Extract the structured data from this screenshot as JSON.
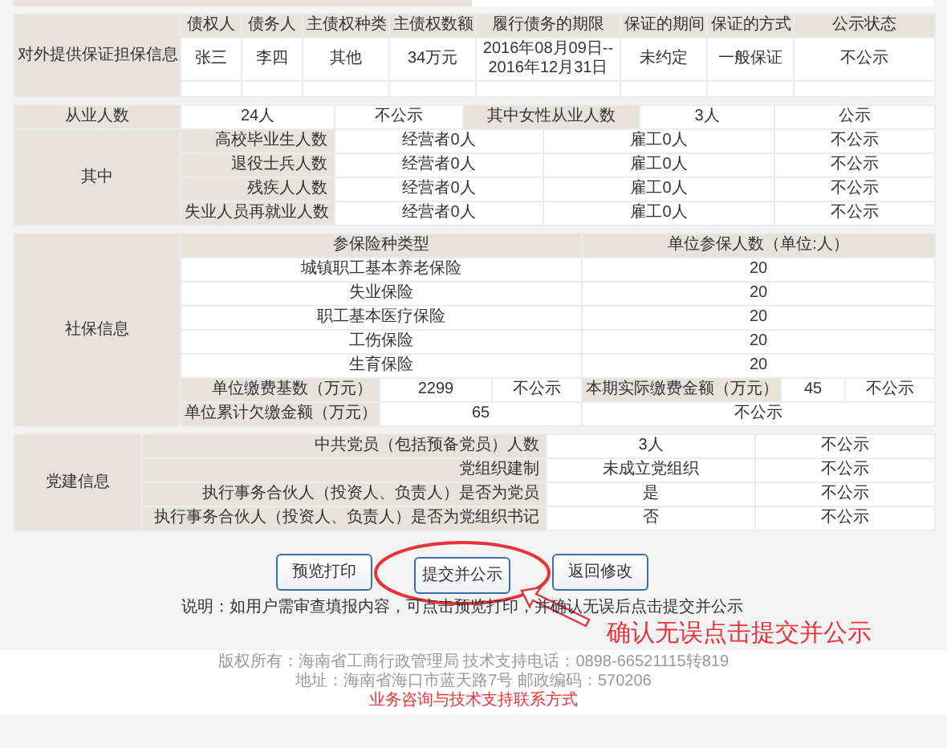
{
  "guarantee": {
    "section_label": "对外提供保证担保信息",
    "columns": [
      "债权人",
      "债务人",
      "主债权种类",
      "主债权数额",
      "履行债务的期限",
      "保证的期间",
      "保证的方式",
      "公示状态"
    ],
    "rows": [
      [
        "张三",
        "李四",
        "其他",
        "34万元",
        "2016年08月09日--2016年12月31日",
        "未约定",
        "一般保证",
        "不公示"
      ]
    ]
  },
  "employment": {
    "total_label": "从业人数",
    "total_value": "24人",
    "total_status": "不公示",
    "female_label": "其中女性从业人数",
    "female_value": "3人",
    "female_status": "公示",
    "breakdown_label": "其中",
    "breakdown": [
      {
        "label": "高校毕业生人数",
        "operators": "经营者0人",
        "employees": "雇工0人",
        "status": "不公示"
      },
      {
        "label": "退役士兵人数",
        "operators": "经营者0人",
        "employees": "雇工0人",
        "status": "不公示"
      },
      {
        "label": "残疾人人数",
        "operators": "经营者0人",
        "employees": "雇工0人",
        "status": "不公示"
      },
      {
        "label": "失业人员再就业人数",
        "operators": "经营者0人",
        "employees": "雇工0人",
        "status": "不公示"
      }
    ]
  },
  "social_insurance": {
    "section_label": "社保信息",
    "header": [
      "参保险种类型",
      "单位参保人数（单位:人）"
    ],
    "types": [
      {
        "name": "城镇职工基本养老保险",
        "count": "20"
      },
      {
        "name": "失业保险",
        "count": "20"
      },
      {
        "name": "职工基本医疗保险",
        "count": "20"
      },
      {
        "name": "工伤保险",
        "count": "20"
      },
      {
        "name": "生育保险",
        "count": "20"
      }
    ],
    "base": {
      "label": "单位缴费基数（万元）",
      "value": "2299",
      "status": "不公示"
    },
    "paid": {
      "label": "本期实际缴费金额（万元）",
      "value": "45",
      "status": "不公示"
    },
    "arrears": {
      "label": "单位累计欠缴金额（万元）",
      "value": "65",
      "status": "不公示"
    }
  },
  "party": {
    "section_label": "党建信息",
    "rows": [
      {
        "label": "中共党员（包括预备党员）人数",
        "value": "3人",
        "status": "不公示"
      },
      {
        "label": "党组织建制",
        "value": "未成立党组织",
        "status": "不公示"
      },
      {
        "label": "执行事务合伙人（投资人、负责人）是否为党员",
        "value": "是",
        "status": "不公示"
      },
      {
        "label": "执行事务合伙人（投资人、负责人）是否为党组织书记",
        "value": "否",
        "status": "不公示"
      }
    ]
  },
  "buttons": [
    {
      "label": "预览打印",
      "highlighted": false
    },
    {
      "label": "提交并公示",
      "highlighted": true
    },
    {
      "label": "返回修改",
      "highlighted": false
    }
  ],
  "note": "说明：如用户需审查填报内容，可点击预览打印，并确认无误后点击提交并公示",
  "annotation": "确认无误点击提交并公示",
  "footer": {
    "copyright": "版权所有：海南省工商行政管理局 技术支持电话：0898-66521115转819",
    "address": "地址：海南省海口市蓝天路7号 邮政编码：570206",
    "contact_link": "业务咨询与技术支持联系方式"
  }
}
